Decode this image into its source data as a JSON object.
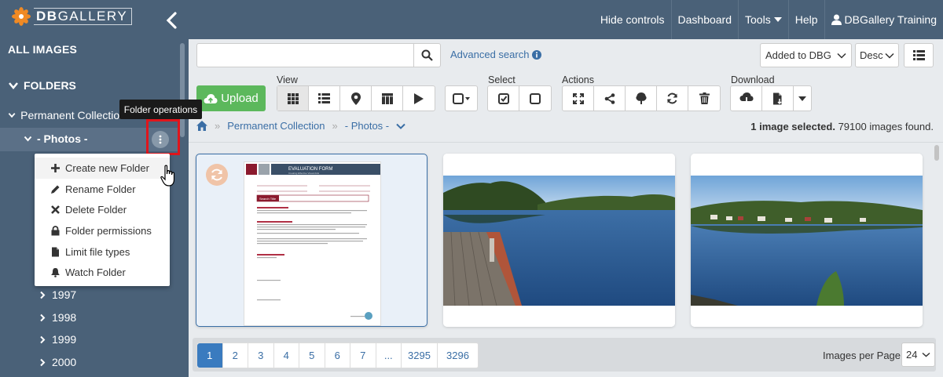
{
  "app": {
    "logo_text_bold": "DB",
    "logo_text": "GALLERY"
  },
  "topnav": {
    "hide_controls": "Hide controls",
    "dashboard": "Dashboard",
    "tools": "Tools",
    "help": "Help",
    "user": "DBGallery Training"
  },
  "sidebar": {
    "all_images": "ALL IMAGES",
    "folders": "FOLDERS",
    "permanent_collection": "Permanent Collection",
    "photos": "- Photos -",
    "years": [
      "1997",
      "1998",
      "1999",
      "2000"
    ]
  },
  "tooltip": "Folder operations",
  "context_menu": {
    "items": [
      "Create new Folder",
      "Rename Folder",
      "Delete Folder",
      "Folder permissions",
      "Limit file types",
      "Watch Folder"
    ]
  },
  "search": {
    "placeholder": "",
    "advanced": "Advanced search"
  },
  "sort": {
    "field": "Added to DBG",
    "order": "Desc"
  },
  "toolbar": {
    "upload": "Upload",
    "view": "View",
    "select": "Select",
    "actions": "Actions",
    "download": "Download"
  },
  "breadcrumb": {
    "root": "Permanent Collection",
    "current": "- Photos -"
  },
  "status": {
    "selected": "1 image selected.",
    "found": "79100 images found."
  },
  "document_thumb": {
    "title": "EVALUATION FORM",
    "subtitle": "Creating Effective Visual Aids",
    "search_title": "Search Title"
  },
  "pagination": {
    "pages": [
      "1",
      "2",
      "3",
      "4",
      "5",
      "6",
      "7",
      "...",
      "3295",
      "3296"
    ],
    "current": "1",
    "per_page_label": "Images per Page:",
    "per_page": "24"
  },
  "colors": {
    "sidebar_bg": "#4a6178",
    "accent_blue": "#3a6ea5",
    "upload_green": "#5cb85c",
    "highlight_red": "#e0151c"
  }
}
